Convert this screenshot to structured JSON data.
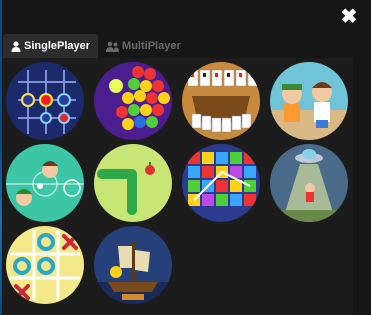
{
  "header": {
    "close_icon": "close-icon"
  },
  "tabs": [
    {
      "label": "SinglePlayer",
      "icon": "user-icon",
      "active": true
    },
    {
      "label": "MultiPlayer",
      "icon": "users-icon",
      "active": false
    }
  ],
  "games": [
    {
      "thumb": "connect-dots-grid",
      "bg": "#1b2a6b"
    },
    {
      "thumb": "bubble-shooter",
      "bg": "#4b1d8f"
    },
    {
      "thumb": "solitaire-cards",
      "bg": "#c88a3d"
    },
    {
      "thumb": "kids-cartoon",
      "bg": "#6fc4d8"
    },
    {
      "thumb": "air-hockey-faces",
      "bg": "#3cc6a6"
    },
    {
      "thumb": "snake",
      "bg": "#c8e676"
    },
    {
      "thumb": "match-three-gems",
      "bg": "#2b3c8f"
    },
    {
      "thumb": "ufo-abduction",
      "bg": "#4a6a8a"
    },
    {
      "thumb": "tic-tac-toe",
      "bg": "#f3e98a"
    },
    {
      "thumb": "pirate-ship",
      "bg": "#26407a"
    }
  ],
  "colors": {
    "panel_bg": "#161616",
    "grid_bg": "#1c1c1c",
    "tab_active_bg": "#2c2c2c",
    "tab_inactive_text": "#6a6a6a"
  }
}
